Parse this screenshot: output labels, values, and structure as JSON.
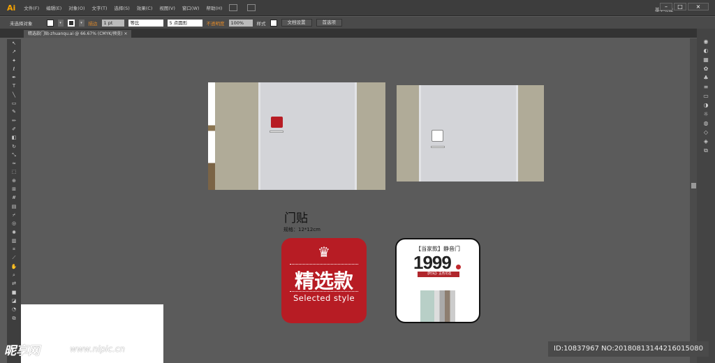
{
  "app": {
    "logo": "Ai",
    "menus": [
      "文件(F)",
      "编辑(E)",
      "对象(O)",
      "文字(T)",
      "选择(S)",
      "效果(C)",
      "视图(V)",
      "窗口(W)",
      "帮助(H)"
    ],
    "workspace": "基本功能",
    "win_min": "–",
    "win_max": "□",
    "win_close": "×"
  },
  "control": {
    "selection": "未选择对象",
    "stroke_label": "描边",
    "stroke_value": "1 pt",
    "line_style": "等比",
    "brush": "5 点圆形",
    "opacity_label": "不透明度",
    "opacity_value": "100%",
    "style_label": "样式",
    "doc_setup": "文档设置",
    "prefs": "首选项"
  },
  "tab": {
    "title": "精选款门贴-zhuanqu.ai @ 66.67% (CMYK/预览)",
    "close": "×"
  },
  "artwork": {
    "title": "门贴",
    "spec": "规格：12*12cm",
    "red_sticker": {
      "crown": "♛",
      "text": "精选款",
      "subtitle": "Selected style",
      "color": "#b71c24"
    },
    "white_sticker": {
      "title": "【当家款】静音门",
      "price": "1999",
      "band": "【时光】· 五色可选"
    }
  },
  "watermark": {
    "site": "昵享网",
    "url": "www.nipic.cn",
    "id": "ID:10837967 NO:20180813144216015080"
  }
}
